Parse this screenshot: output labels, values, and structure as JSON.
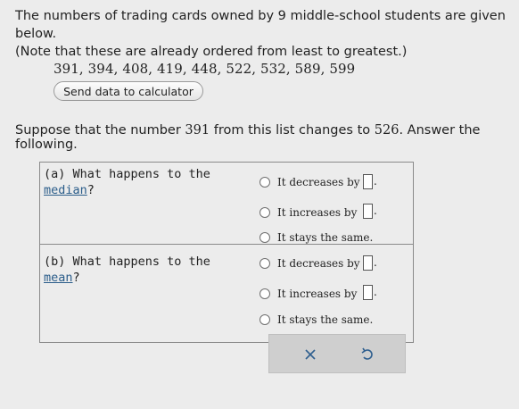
{
  "intro": {
    "line1": "The numbers of trading cards owned by 9 middle-school students are given below.",
    "line2": "(Note that these are already ordered from least to greatest.)"
  },
  "data_list": "391, 394, 408, 419, 448, 522, 532, 589, 599",
  "send_button_label": "Send data to calculator",
  "suppose": {
    "before": "Suppose that the number ",
    "num1": "391",
    "middle": " from this list changes to ",
    "num2": "526",
    "after": ". Answer the following."
  },
  "questions": [
    {
      "prefix": "(a)  What happens to the",
      "link": "median",
      "suffix": "?",
      "options": [
        "It decreases by",
        "It increases by",
        "It stays the same."
      ]
    },
    {
      "prefix": "(b)  What happens to the",
      "link": "mean",
      "suffix": "?",
      "options": [
        "It decreases by",
        "It increases by",
        "It stays the same."
      ]
    }
  ],
  "answer_suffix": ".",
  "toolbar": {
    "clear_icon": "close-icon",
    "undo_icon": "undo-icon"
  }
}
